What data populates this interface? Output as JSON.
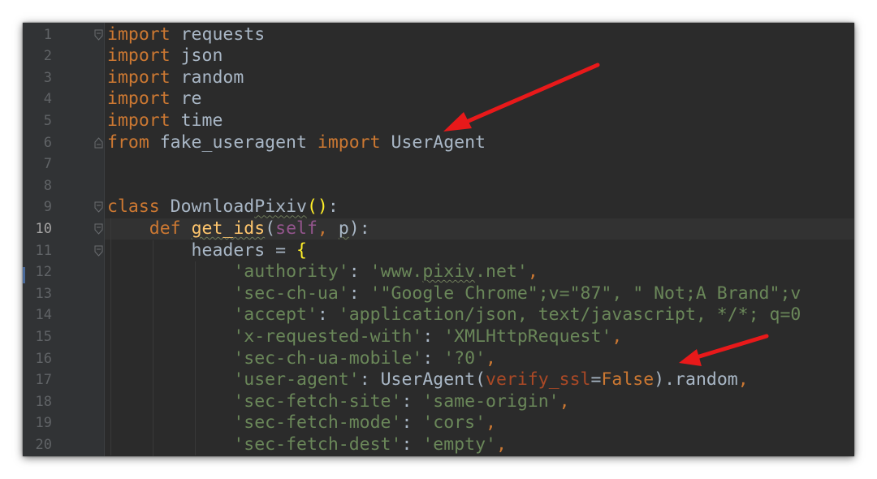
{
  "editor": {
    "current_line": "10",
    "line_numbers": [
      "1",
      "2",
      "3",
      "4",
      "5",
      "6",
      "7",
      "8",
      "9",
      "10",
      "11",
      "12",
      "13",
      "14",
      "15",
      "16",
      "17",
      "18",
      "19",
      "20"
    ],
    "lines": [
      [
        [
          "kw",
          "import"
        ],
        [
          "plain",
          " requests"
        ]
      ],
      [
        [
          "kw",
          "import"
        ],
        [
          "plain",
          " json"
        ]
      ],
      [
        [
          "kw",
          "import"
        ],
        [
          "plain",
          " random"
        ]
      ],
      [
        [
          "kw",
          "import"
        ],
        [
          "plain",
          " re"
        ]
      ],
      [
        [
          "kw",
          "import"
        ],
        [
          "plain",
          " time"
        ]
      ],
      [
        [
          "kw",
          "from"
        ],
        [
          "plain",
          " fake_useragent "
        ],
        [
          "kw",
          "import"
        ],
        [
          "plain",
          " UserAgent"
        ]
      ],
      [],
      [],
      [
        [
          "kw",
          "class"
        ],
        [
          "plain",
          " Download"
        ],
        [
          "plain squig",
          "Pixiv"
        ],
        [
          "brace-match",
          "()"
        ],
        [
          "plain",
          ":"
        ]
      ],
      [
        [
          "plain",
          "    "
        ],
        [
          "kw",
          "def"
        ],
        [
          "plain",
          " "
        ],
        [
          "fn squig",
          "get_ids"
        ],
        [
          "plain",
          "("
        ],
        [
          "self",
          "self"
        ],
        [
          "kw",
          ", "
        ],
        [
          "plain squig",
          "p"
        ],
        [
          "plain",
          "):"
        ]
      ],
      [
        [
          "plain",
          "        headers = "
        ],
        [
          "brace-match",
          "{"
        ]
      ],
      [
        [
          "plain",
          "            "
        ],
        [
          "str",
          "'authority'"
        ],
        [
          "plain",
          ": "
        ],
        [
          "str",
          "'www."
        ],
        [
          "str squig",
          "pixiv"
        ],
        [
          "str",
          ".net'"
        ],
        [
          "kw",
          ","
        ]
      ],
      [
        [
          "plain",
          "            "
        ],
        [
          "str",
          "'sec-ch-ua'"
        ],
        [
          "plain",
          ": "
        ],
        [
          "str",
          "'\"Google Chrome\";v=\"87\", \" Not;A Brand\";v"
        ]
      ],
      [
        [
          "plain",
          "            "
        ],
        [
          "str",
          "'accept'"
        ],
        [
          "plain",
          ": "
        ],
        [
          "str",
          "'application/json, text/javascript, */*; q=0"
        ]
      ],
      [
        [
          "plain",
          "            "
        ],
        [
          "str",
          "'x-requested-with'"
        ],
        [
          "plain",
          ": "
        ],
        [
          "str",
          "'XMLHttpRequest'"
        ],
        [
          "kw",
          ","
        ]
      ],
      [
        [
          "plain",
          "            "
        ],
        [
          "str",
          "'sec-ch-ua-mobile'"
        ],
        [
          "plain",
          ": "
        ],
        [
          "str",
          "'?0'"
        ],
        [
          "kw",
          ","
        ]
      ],
      [
        [
          "plain",
          "            "
        ],
        [
          "str",
          "'user-agent'"
        ],
        [
          "plain",
          ": UserAgent("
        ],
        [
          "param",
          "verify_ssl"
        ],
        [
          "plain",
          "="
        ],
        [
          "kw",
          "False"
        ],
        [
          "plain",
          ").random"
        ],
        [
          "kw",
          ","
        ]
      ],
      [
        [
          "plain",
          "            "
        ],
        [
          "str",
          "'sec-fetch-site'"
        ],
        [
          "plain",
          ": "
        ],
        [
          "str",
          "'same-origin'"
        ],
        [
          "kw",
          ","
        ]
      ],
      [
        [
          "plain",
          "            "
        ],
        [
          "str",
          "'sec-fetch-mode'"
        ],
        [
          "plain",
          ": "
        ],
        [
          "str",
          "'cors'"
        ],
        [
          "kw",
          ","
        ]
      ],
      [
        [
          "plain",
          "            "
        ],
        [
          "str",
          "'sec-fetch-dest'"
        ],
        [
          "plain",
          ": "
        ],
        [
          "str",
          "'empty'"
        ],
        [
          "kw",
          ","
        ]
      ]
    ]
  },
  "annotations": {
    "arrow_color": "#e8191a",
    "arrows": [
      "arrow-to-useragent-import",
      "arrow-to-verify-ssl"
    ]
  },
  "colors": {
    "background": "#2b2b2b",
    "gutter": "#313335",
    "keyword": "#cc7832",
    "string": "#6a8759",
    "self": "#94558d",
    "parameter": "#aa4926",
    "function": "#ffc66d",
    "text": "#a9b7c6"
  }
}
